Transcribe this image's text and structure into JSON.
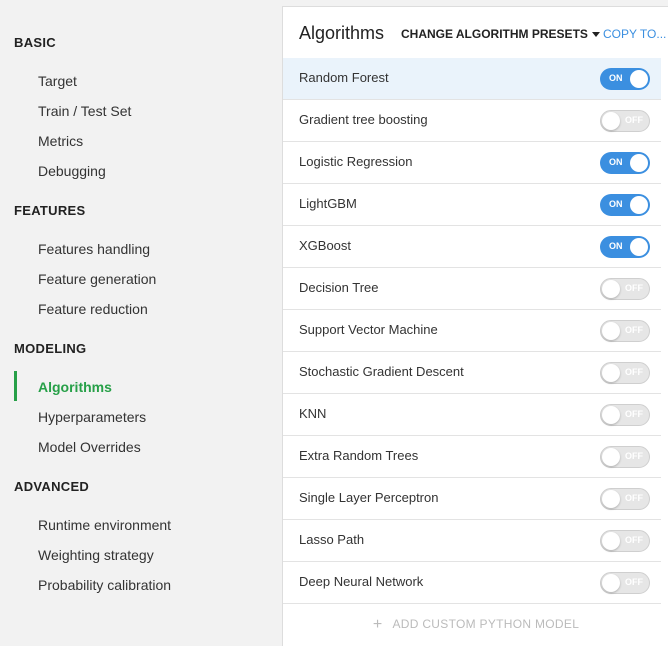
{
  "sidebar": {
    "sections": [
      {
        "title": "BASIC",
        "items": [
          "Target",
          "Train / Test Set",
          "Metrics",
          "Debugging"
        ]
      },
      {
        "title": "FEATURES",
        "items": [
          "Features handling",
          "Feature generation",
          "Feature reduction"
        ]
      },
      {
        "title": "MODELING",
        "items": [
          "Algorithms",
          "Hyperparameters",
          "Model Overrides"
        ]
      },
      {
        "title": "ADVANCED",
        "items": [
          "Runtime environment",
          "Weighting strategy",
          "Probability calibration"
        ]
      }
    ],
    "active_item": "Algorithms"
  },
  "panel": {
    "title": "Algorithms",
    "presets_label": "CHANGE ALGORITHM PRESETS",
    "copy_label": "COPY TO...",
    "on_label": "ON",
    "off_label": "OFF",
    "algorithms": [
      {
        "name": "Random Forest",
        "enabled": true
      },
      {
        "name": "Gradient tree boosting",
        "enabled": false
      },
      {
        "name": "Logistic Regression",
        "enabled": true
      },
      {
        "name": "LightGBM",
        "enabled": true
      },
      {
        "name": "XGBoost",
        "enabled": true
      },
      {
        "name": "Decision Tree",
        "enabled": false
      },
      {
        "name": "Support Vector Machine",
        "enabled": false
      },
      {
        "name": "Stochastic Gradient Descent",
        "enabled": false
      },
      {
        "name": "KNN",
        "enabled": false
      },
      {
        "name": "Extra Random Trees",
        "enabled": false
      },
      {
        "name": "Single Layer Perceptron",
        "enabled": false
      },
      {
        "name": "Lasso Path",
        "enabled": false
      },
      {
        "name": "Deep Neural Network",
        "enabled": false
      }
    ],
    "add_label": "ADD CUSTOM PYTHON MODEL"
  },
  "colors": {
    "accent_green": "#27a048",
    "accent_blue": "#3b8fe0"
  }
}
